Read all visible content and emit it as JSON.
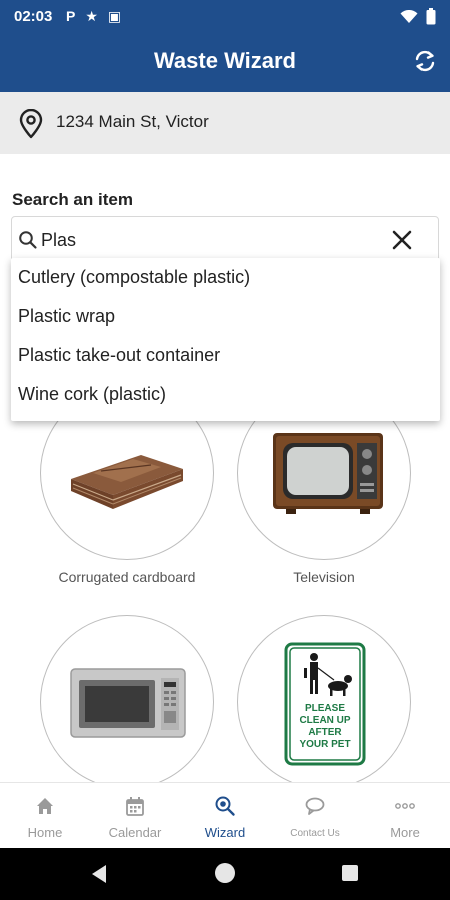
{
  "status_bar": {
    "time": "02:03",
    "icons_left": [
      "P",
      "★",
      "▣"
    ]
  },
  "app_bar": {
    "title": "Waste Wizard"
  },
  "address": {
    "text": "1234 Main St, Victor"
  },
  "search": {
    "label": "Search an item",
    "value": "Plas"
  },
  "suggestions": [
    "Cutlery (compostable plastic)",
    "Plastic wrap",
    "Plastic take-out container",
    "Wine cork (plastic)"
  ],
  "items": [
    {
      "label": "Corrugated cardboard"
    },
    {
      "label": "Television"
    },
    {
      "label": ""
    },
    {
      "label": ""
    }
  ],
  "sign": {
    "line1": "PLEASE",
    "line2": "CLEAN UP",
    "line3": "AFTER",
    "line4": "YOUR PET"
  },
  "bottom_nav": [
    {
      "label": "Home",
      "icon": "home-icon"
    },
    {
      "label": "Calendar",
      "icon": "calendar-icon"
    },
    {
      "label": "Wizard",
      "icon": "wizard-icon"
    },
    {
      "label": "Contact Us",
      "icon": "chat-icon"
    },
    {
      "label": "More",
      "icon": "more-icon"
    }
  ],
  "colors": {
    "primary": "#1f4e8c",
    "inactive": "#9a9a9a",
    "sign_green": "#1e7a45"
  }
}
